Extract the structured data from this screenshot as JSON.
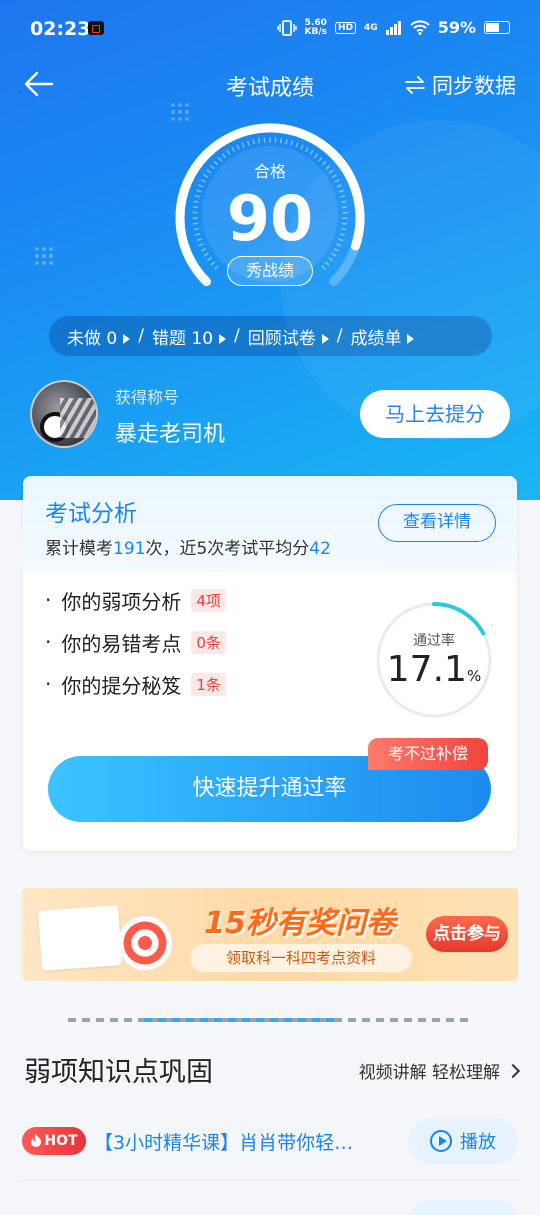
{
  "status": {
    "time": "02:23",
    "speed_top": "5.60",
    "speed_unit": "KB/s",
    "hd": "HD",
    "network": "4G",
    "battery": "59%",
    "battery_level": 0.59
  },
  "nav": {
    "title": "考试成绩",
    "sync_label": "同步数据"
  },
  "score": {
    "label": "合格",
    "value": "90",
    "show_button": "秀战绩",
    "progress": 0.9
  },
  "links": [
    {
      "label": "未做 0"
    },
    {
      "label": "错题  10"
    },
    {
      "label": "回顾试卷"
    },
    {
      "label": "成绩单"
    }
  ],
  "profile": {
    "title_label": "获得称号",
    "title_value": "暴走老司机",
    "boost_button": "马上去提分"
  },
  "analysis": {
    "title": "考试分析",
    "detail_button": "查看详情",
    "summary_prefix": "累计模考",
    "total_exams": "191",
    "summary_mid": "次，近5次考试平均分",
    "average": "42",
    "items": [
      {
        "label": "你的弱项分析",
        "badge": "4项"
      },
      {
        "label": "你的易错考点",
        "badge": "0条"
      },
      {
        "label": "你的提分秘笈",
        "badge": "1条"
      }
    ],
    "pass_rate_label": "通过率",
    "pass_rate_value": "17.1",
    "pass_rate_unit": "%",
    "pass_rate": 0.171,
    "main_button": "快速提升通过率",
    "compensation_tag": "考不过补偿"
  },
  "banner": {
    "title": "15秒有奖问卷",
    "subtitle": "领取科一科四考点资料",
    "button": "点击参与"
  },
  "weak_section": {
    "title": "弱项知识点巩固",
    "more_label": "视频讲解 轻松理解",
    "items": [
      {
        "hot": "HOT",
        "text": "【3小时精华课】肖肖带你轻…",
        "button": "播放"
      }
    ]
  },
  "colors": {
    "primary": "#1a86e8",
    "hero_start": "#1d76f0",
    "hero_end": "#19b6f4",
    "danger": "#e6403f",
    "banner_orange": "#ff6a1a"
  }
}
